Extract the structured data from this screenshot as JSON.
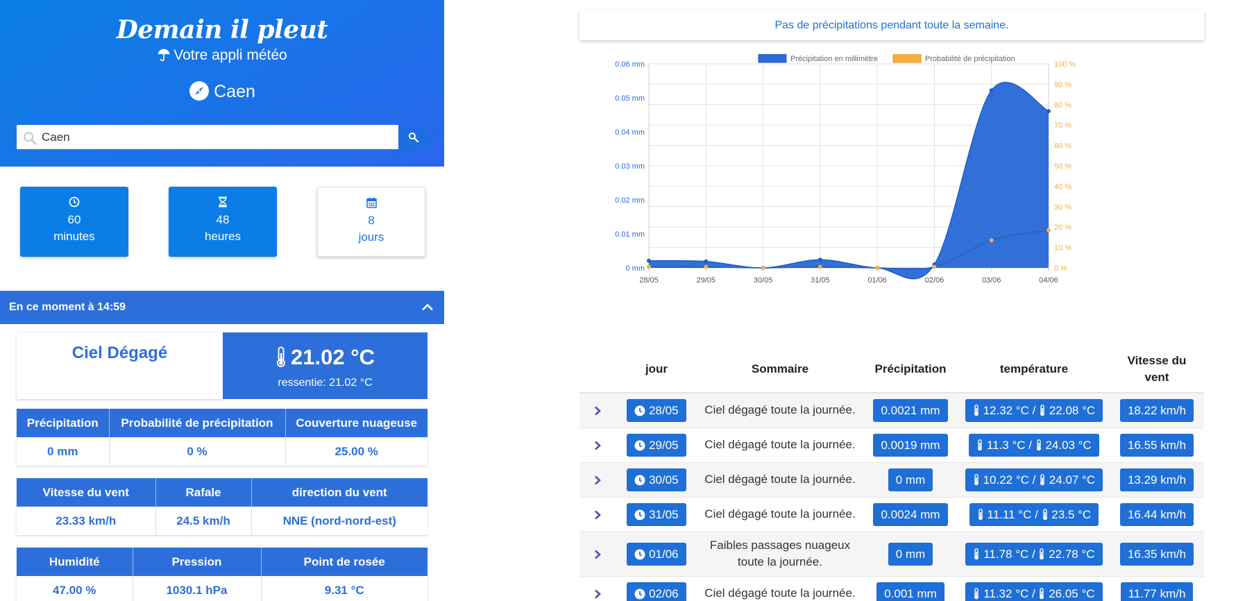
{
  "app": {
    "brand": "Demain il pleut",
    "tagline": "Votre appli météo",
    "city": "Caen"
  },
  "search": {
    "value": "Caen"
  },
  "modes": [
    {
      "value": "60",
      "unit": "minutes",
      "icon": "clock-icon",
      "active": true
    },
    {
      "value": "48",
      "unit": "heures",
      "icon": "hourglass-icon",
      "active": true
    },
    {
      "value": "8",
      "unit": "jours",
      "icon": "calendar-icon",
      "active": false
    }
  ],
  "current": {
    "header": "En ce moment à 14:59",
    "sky": "Ciel Dégagé",
    "temperature": "21.02 °C",
    "feels_like": "ressentie: 21.02 °C",
    "tables": [
      {
        "headers": [
          "Précipitation",
          "Probabilité de précipitation",
          "Couverture nuageuse"
        ],
        "values": [
          "0 mm",
          "0 %",
          "25.00 %"
        ]
      },
      {
        "headers": [
          "Vitesse du vent",
          "Rafale",
          "direction du vent"
        ],
        "values": [
          "23.33 km/h",
          "24.5 km/h",
          "NNE (nord-nord-est)"
        ]
      },
      {
        "headers": [
          "Humidité",
          "Pression",
          "Point de rosée"
        ],
        "values": [
          "47.00 %",
          "1030.1 hPa",
          "9.31 °C"
        ]
      }
    ]
  },
  "notice": "Pas de précipitations pendant toute la semaine.",
  "chart_data": {
    "type": "area",
    "x": [
      "28/05",
      "29/05",
      "30/05",
      "31/05",
      "01/06",
      "02/06",
      "03/06",
      "04/06"
    ],
    "series": [
      {
        "name": "Précipitation en millimètre",
        "axis": "left",
        "unit": "mm",
        "color": "#2a6bd8",
        "values": [
          0.0021,
          0.0019,
          0,
          0.0024,
          0,
          0.001,
          0.0522,
          0.0461
        ]
      },
      {
        "name": "Probabilité de précipitation",
        "axis": "right",
        "unit": "%",
        "color": "#f7ad3c",
        "values": [
          0.5,
          0.5,
          0,
          0.5,
          0,
          0.5,
          13.5,
          18.5
        ]
      }
    ],
    "y_left": {
      "ticks": [
        "0 mm",
        "0.01 mm",
        "0.02 mm",
        "0.03 mm",
        "0.04 mm",
        "0.05 mm",
        "0.06 mm"
      ],
      "range": [
        0,
        0.06
      ],
      "color": "#2a6bd8"
    },
    "y_right": {
      "ticks": [
        "0 %",
        "10 %",
        "20 %",
        "30 %",
        "40 %",
        "50 %",
        "60 %",
        "70 %",
        "80 %",
        "90 %",
        "100 %"
      ],
      "range": [
        0,
        100
      ],
      "color": "#f7ad3c"
    },
    "grid": true,
    "legend": "top"
  },
  "forecast": {
    "headers": [
      "jour",
      "Sommaire",
      "Précipitation",
      "température",
      "Vitesse du vent"
    ],
    "rows": [
      {
        "date": "28/05",
        "summary": "Ciel dégagé toute la journée.",
        "precip": "0.0021 mm",
        "tmin": "12.32 °C /",
        "tmax": "22.08 °C",
        "wind": "18.22 km/h"
      },
      {
        "date": "29/05",
        "summary": "Ciel dégagé toute la journée.",
        "precip": "0.0019 mm",
        "tmin": "11.3 °C /",
        "tmax": "24.03 °C",
        "wind": "16.55 km/h"
      },
      {
        "date": "30/05",
        "summary": "Ciel dégagé toute la journée.",
        "precip": "0 mm",
        "tmin": "10.22 °C /",
        "tmax": "24.07 °C",
        "wind": "13.29 km/h"
      },
      {
        "date": "31/05",
        "summary": "Ciel dégagé toute la journée.",
        "precip": "0.0024 mm",
        "tmin": "11.11 °C /",
        "tmax": "23.5 °C",
        "wind": "16.44 km/h"
      },
      {
        "date": "01/06",
        "summary": "Faibles passages nuageux toute la journée.",
        "precip": "0 mm",
        "tmin": "11.78 °C /",
        "tmax": "22.78 °C",
        "wind": "16.35 km/h"
      },
      {
        "date": "02/06",
        "summary": "Ciel dégagé toute la journée.",
        "precip": "0.001 mm",
        "tmin": "11.32 °C /",
        "tmax": "26.05 °C",
        "wind": "11.77 km/h"
      }
    ]
  }
}
